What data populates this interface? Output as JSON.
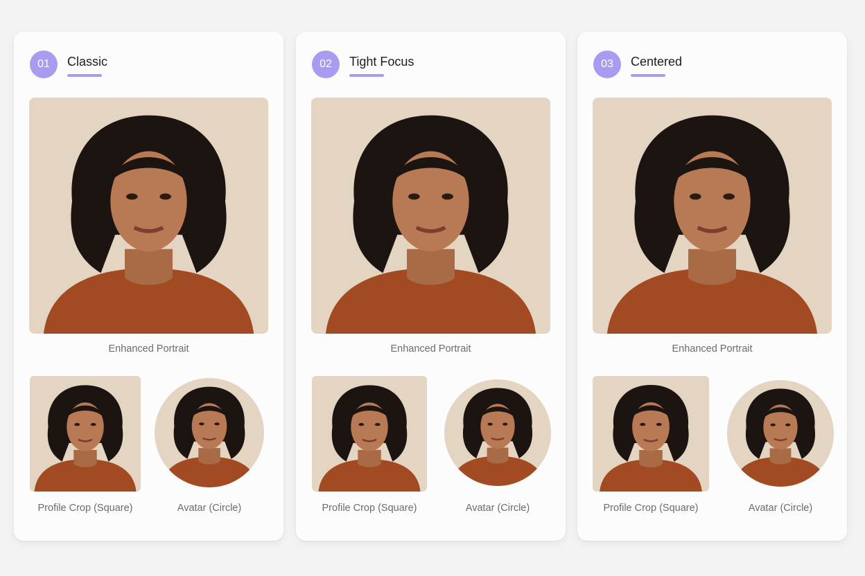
{
  "cards": [
    {
      "number": "01",
      "title": "Classic",
      "main_caption": "Enhanced Portrait",
      "square_caption": "Profile Crop (Square)",
      "circle_caption": "Avatar (Circle)"
    },
    {
      "number": "02",
      "title": "Tight Focus",
      "main_caption": "Enhanced Portrait",
      "square_caption": "Profile Crop (Square)",
      "circle_caption": "Avatar (Circle)"
    },
    {
      "number": "03",
      "title": "Centered",
      "main_caption": "Enhanced Portrait",
      "square_caption": "Profile Crop (Square)",
      "circle_caption": "Avatar (Circle)"
    }
  ],
  "colors": {
    "accent": "#a99bf0",
    "photo_background": "#e4d4c2",
    "sweater": "#a24a22",
    "hair": "#1c1410",
    "skin": "#b87a54"
  }
}
